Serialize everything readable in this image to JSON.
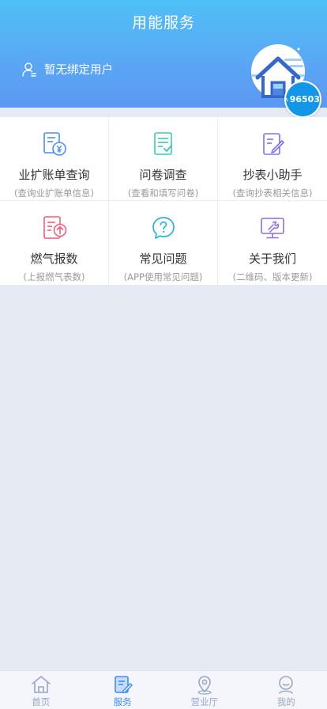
{
  "header": {
    "title": "用能服务",
    "user_text": "暂无绑定用户",
    "hotline": "96503"
  },
  "grid": [
    {
      "title": "业扩账单查询",
      "sub": "(查询业扩账单信息)",
      "icon": "bill-icon",
      "color": "#4b8df0"
    },
    {
      "title": "问卷调查",
      "sub": "(查看和填写问卷)",
      "icon": "survey-icon",
      "color": "#3ec7b6"
    },
    {
      "title": "抄表小助手",
      "sub": "(查询抄表相关信息)",
      "icon": "meter-edit-icon",
      "color": "#7e72e8"
    },
    {
      "title": "燃气报数",
      "sub": "(上报燃气表数)",
      "icon": "gas-report-icon",
      "color": "#ec5f7e"
    },
    {
      "title": "常见问题",
      "sub": "(APP使用常见问题)",
      "icon": "faq-icon",
      "color": "#2bb2d6"
    },
    {
      "title": "关于我们",
      "sub": "(二维码、版本更新)",
      "icon": "about-icon",
      "color": "#8a6fe0"
    }
  ],
  "tabbar": [
    {
      "label": "首页",
      "icon": "home-icon",
      "active": false
    },
    {
      "label": "服务",
      "icon": "service-icon",
      "active": true
    },
    {
      "label": "营业厅",
      "icon": "location-icon",
      "active": false
    },
    {
      "label": "我的",
      "icon": "profile-icon",
      "active": false
    }
  ]
}
